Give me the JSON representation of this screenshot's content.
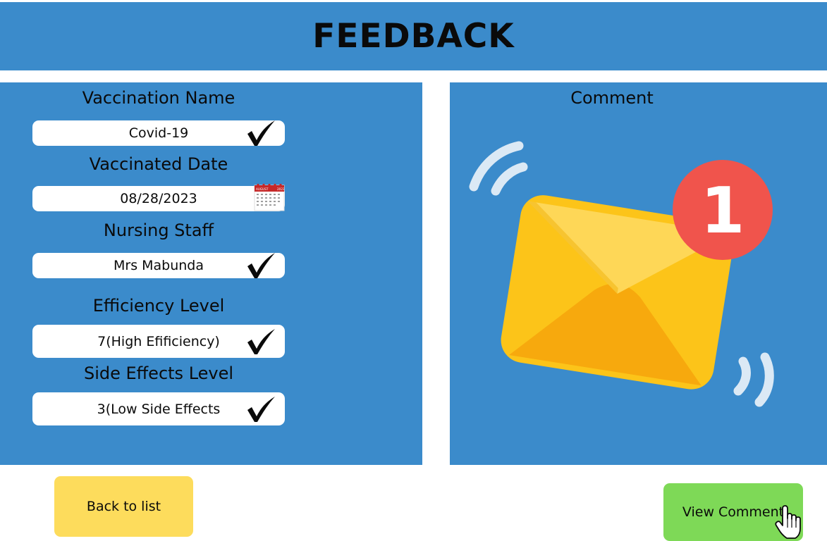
{
  "header": {
    "title": "FEEDBACK"
  },
  "fields": [
    {
      "label": "Vaccination Name",
      "value": "Covid-19",
      "icon": "checkmark-icon"
    },
    {
      "label": "Vaccinated Date",
      "value": "08/28/2023",
      "icon": "calendar-icon"
    },
    {
      "label": "Nursing Staff",
      "value": "Mrs Mabunda",
      "icon": "checkmark-icon"
    },
    {
      "label": "Efficiency Level",
      "value": "7(High Efificiency)",
      "icon": "checkmark-icon"
    },
    {
      "label": "Side Effects Level",
      "value": "3(Low Side Effects",
      "icon": "checkmark-icon"
    }
  ],
  "calendar": {
    "month": "AUGUST",
    "year": "2023"
  },
  "comment": {
    "title": "Comment",
    "notification_count": "1",
    "icon": "envelope-notification-icon"
  },
  "buttons": {
    "back_label": "Back to list",
    "view_label": "View Comment"
  },
  "colors": {
    "panel_blue": "#3b8bcb",
    "back_button": "#fddc5c",
    "view_button": "#7ed957",
    "badge_red": "#f0544c",
    "envelope_yellow": "#fcc419"
  }
}
